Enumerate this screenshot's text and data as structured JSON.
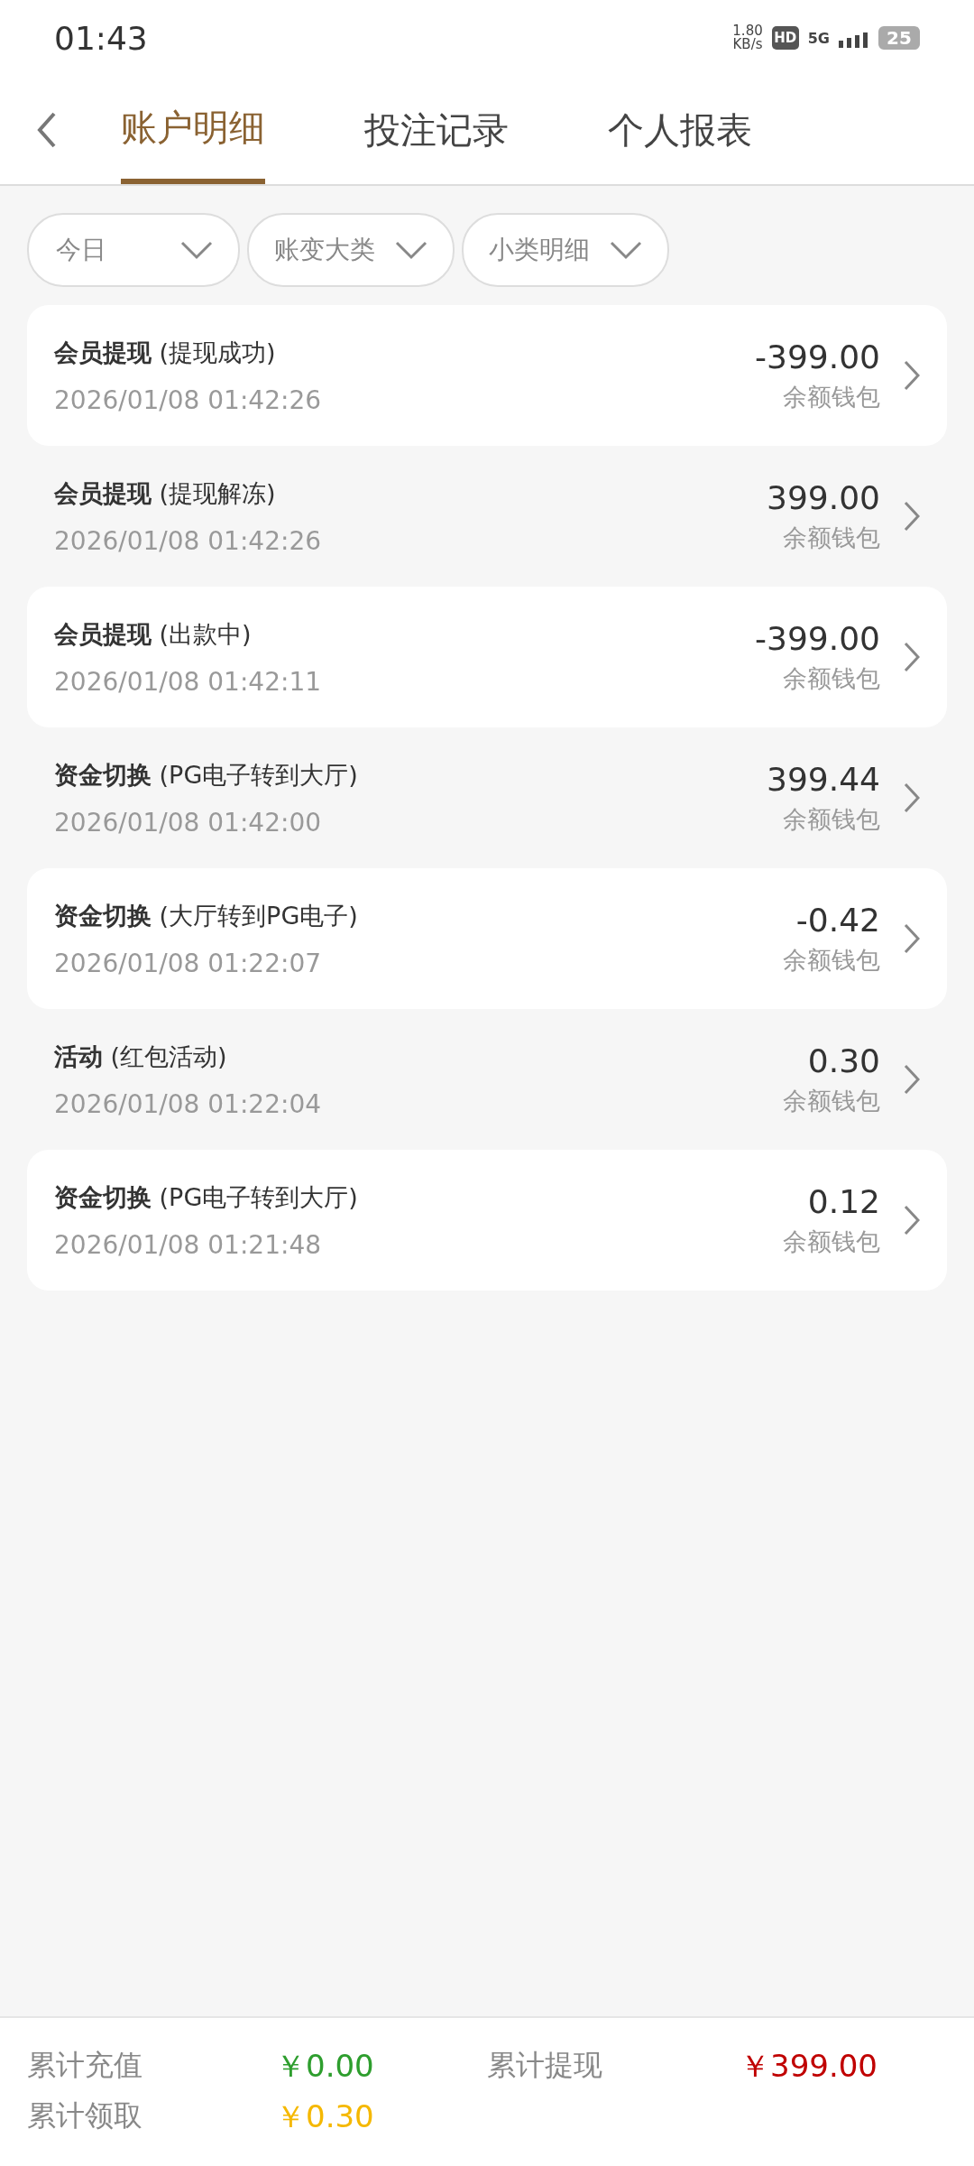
{
  "status_bar": {
    "time": "01:43",
    "speed": "1.80",
    "speed_unit": "KB/s",
    "hd": "HD",
    "network": "5G",
    "battery": "25"
  },
  "tabs": [
    {
      "label": "账户明细",
      "selected": true
    },
    {
      "label": "投注记录",
      "selected": false
    },
    {
      "label": "个人报表",
      "selected": false
    }
  ],
  "filters": [
    {
      "label": "今日"
    },
    {
      "label": "账变大类"
    },
    {
      "label": "小类明细"
    }
  ],
  "records": [
    {
      "title": "**会员提现** (提现成功)",
      "time": "2026/01/08 01:42:26",
      "amount": "-399.00",
      "wallet": "余额钱包"
    },
    {
      "title": "**会员提现** (提现解冻)",
      "time": "2026/01/08 01:42:26",
      "amount": "399.00",
      "wallet": "余额钱包"
    },
    {
      "title": "**会员提现** (出款中)",
      "time": "2026/01/08 01:42:11",
      "amount": "-399.00",
      "wallet": "余额钱包"
    },
    {
      "title": "**资金切换** (PG电子转到大厅)",
      "time": "2026/01/08 01:42:00",
      "amount": "399.44",
      "wallet": "余额钱包"
    },
    {
      "title": "**资金切换** (大厅转到PG电子)",
      "time": "2026/01/08 01:22:07",
      "amount": "-0.42",
      "wallet": "余额钱包"
    },
    {
      "title": "**活动** (红包活动)",
      "time": "2026/01/08 01:22:04",
      "amount": "0.30",
      "wallet": "余额钱包"
    },
    {
      "title": "**资金切换** (PG电子转到大厅)",
      "time": "2026/01/08 01:21:48",
      "amount": "0.12",
      "wallet": "余额钱包"
    }
  ],
  "summary": [
    {
      "label": "累计充值",
      "value": "￥0.00",
      "color": "#2e9e2e"
    },
    {
      "label": "累计提现",
      "value": "￥399.00",
      "color": "#c00000"
    },
    {
      "label": "累计领取",
      "value": "￥0.30",
      "color": "#f5b800"
    }
  ]
}
